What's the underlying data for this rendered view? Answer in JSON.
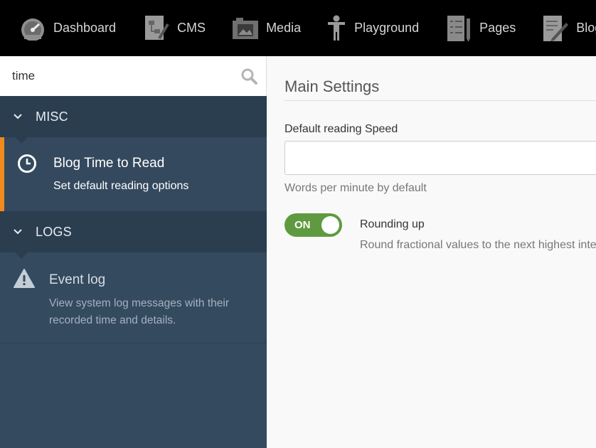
{
  "nav": {
    "items": [
      {
        "label": "Dashboard",
        "icon": "dashboard-gauge-icon"
      },
      {
        "label": "CMS",
        "icon": "cms-sitemap-icon"
      },
      {
        "label": "Media",
        "icon": "media-camera-icon"
      },
      {
        "label": "Playground",
        "icon": "playground-figure-icon"
      },
      {
        "label": "Pages",
        "icon": "pages-document-icon"
      },
      {
        "label": "Blog",
        "icon": "blog-pencil-icon"
      }
    ]
  },
  "sidebar": {
    "search": {
      "value": "time",
      "icon": "search-icon"
    },
    "sections": [
      {
        "label": "MISC",
        "items": [
          {
            "title": "Blog Time to Read",
            "description": "Set default reading options",
            "icon": "clock-icon",
            "active": true
          }
        ]
      },
      {
        "label": "LOGS",
        "items": [
          {
            "title": "Event log",
            "description": "View system log messages with their recorded time and details.",
            "icon": "warning-icon",
            "active": false
          }
        ]
      }
    ]
  },
  "main": {
    "title": "Main Settings",
    "reading_speed": {
      "label": "Default reading Speed",
      "value": "",
      "help": "Words per minute by default"
    },
    "rounding": {
      "toggle_label": "ON",
      "state": true,
      "label": "Rounding up",
      "description": "Round fractional values to the next highest integer"
    }
  },
  "colors": {
    "accent": "#f08a1c",
    "toggle_on": "#5f9a40",
    "sidebar_bg": "#344a5f",
    "topnav_bg": "#000000"
  }
}
